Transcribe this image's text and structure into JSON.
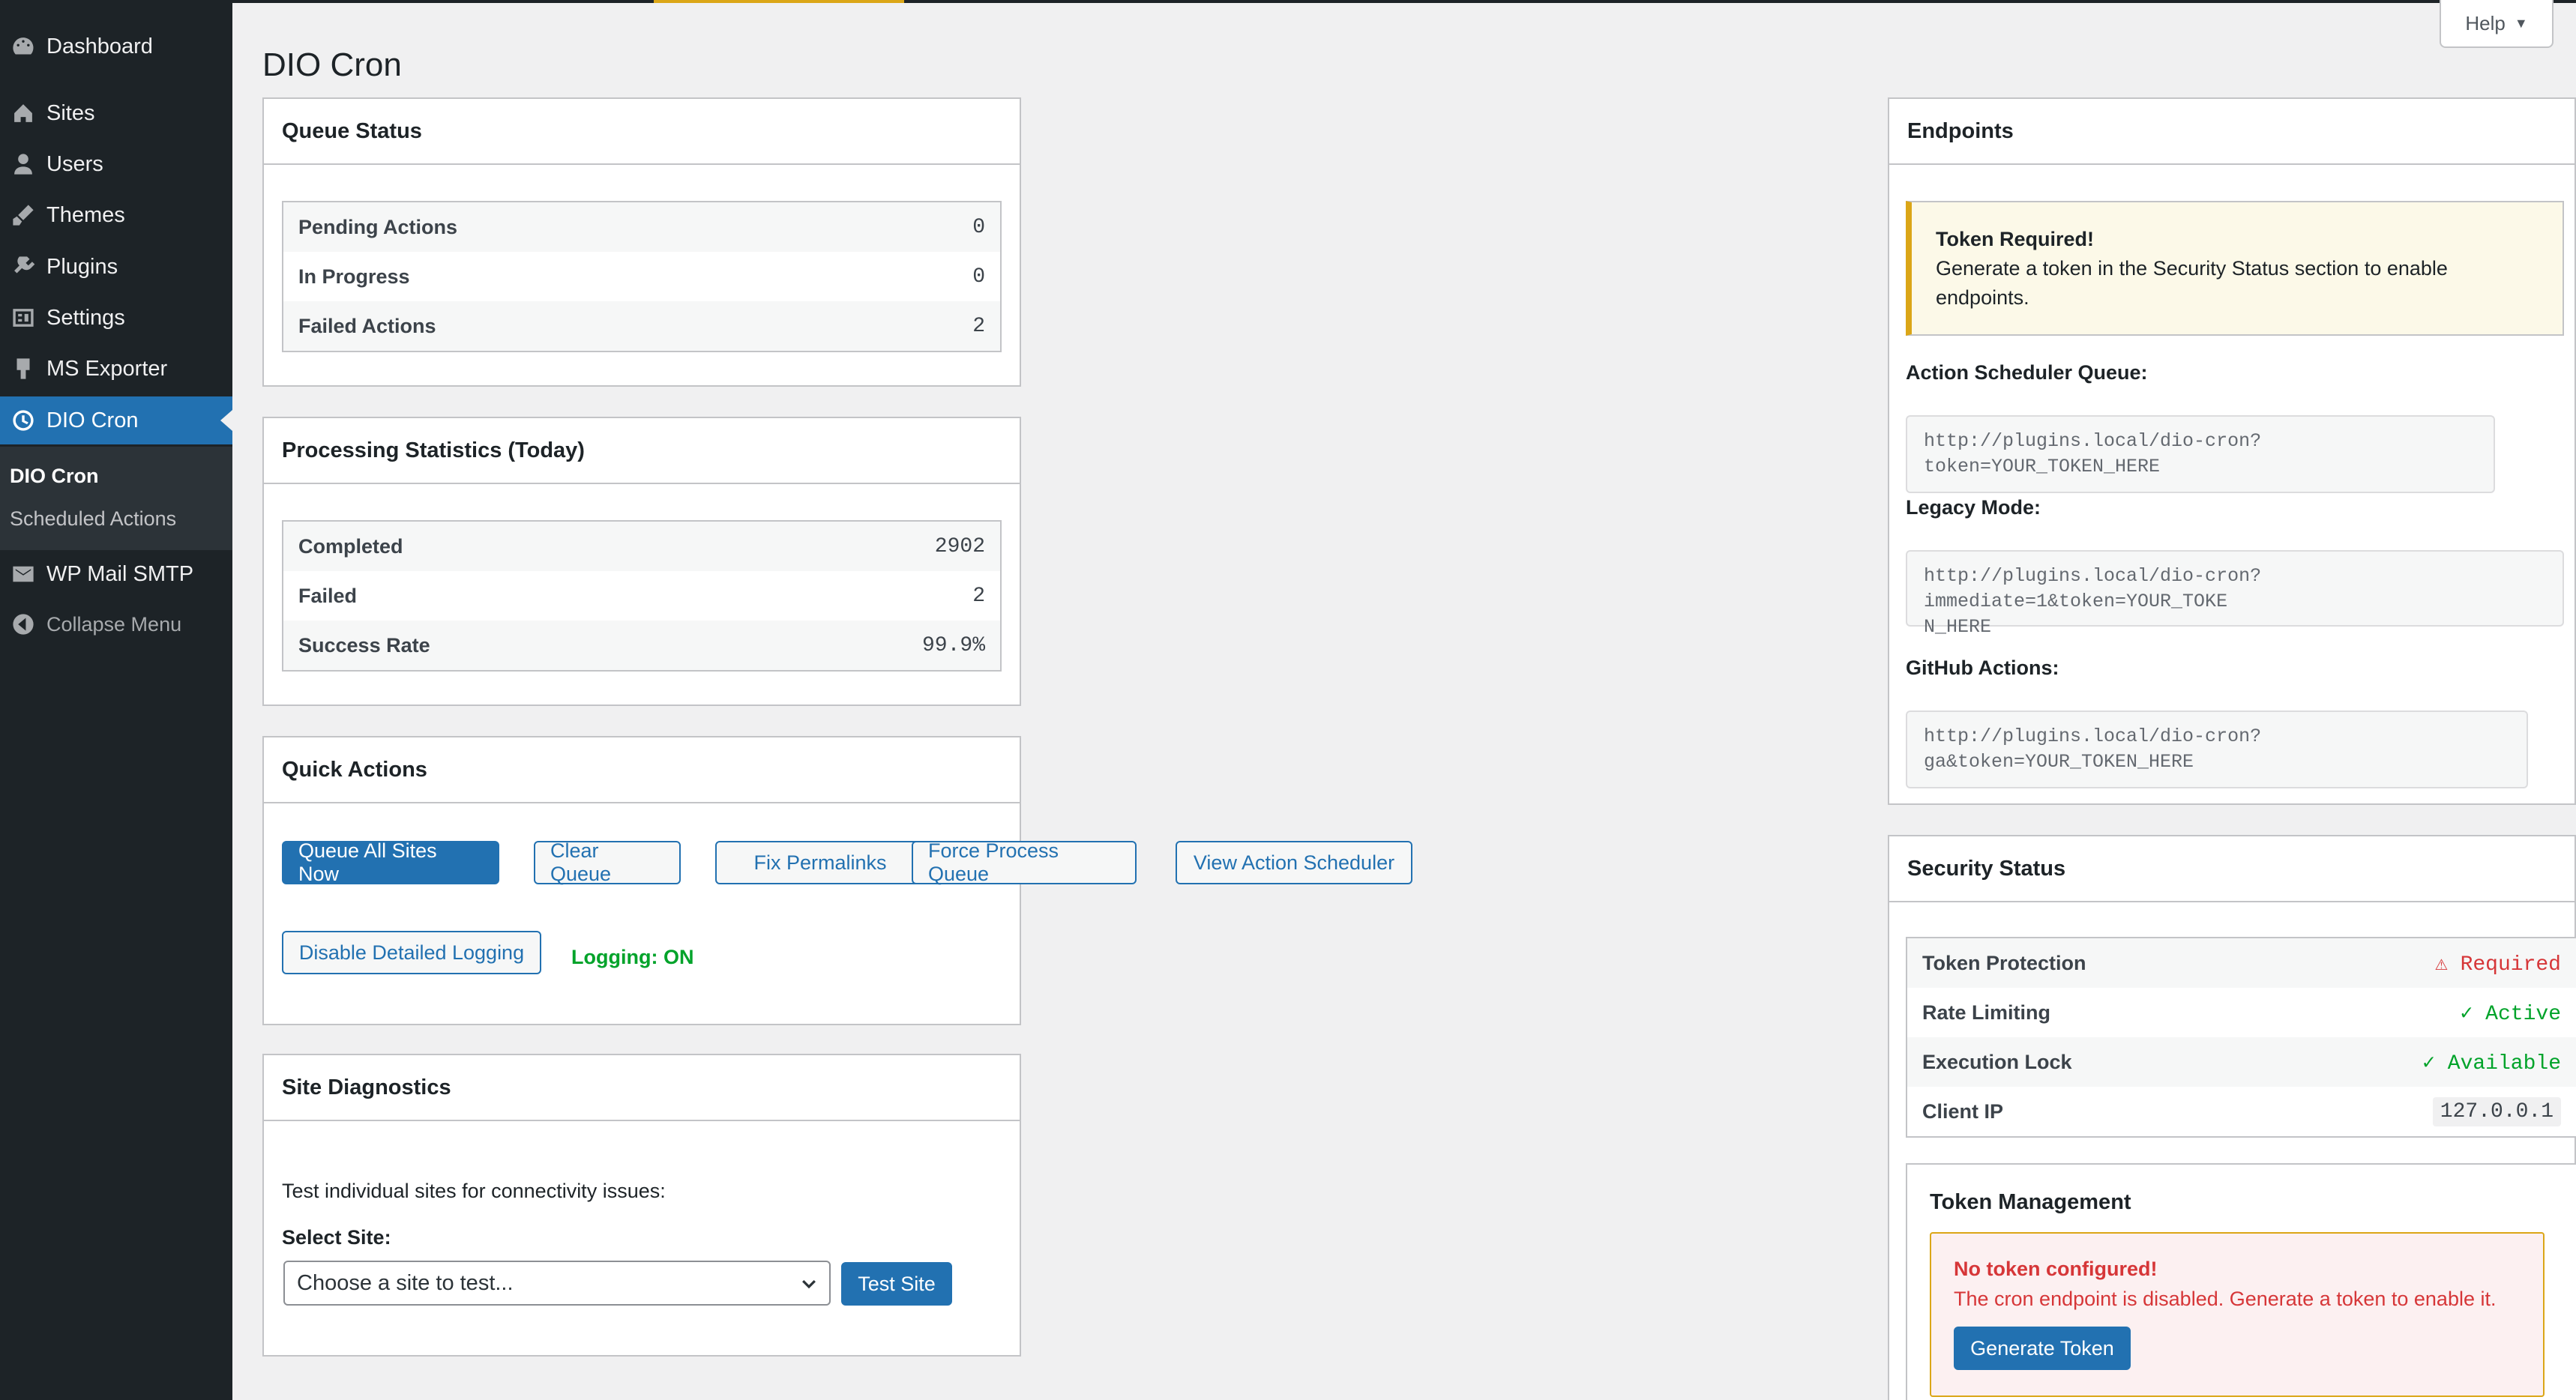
{
  "sidebar": {
    "items": [
      {
        "label": "Dashboard",
        "icon": "dashboard-icon"
      },
      {
        "label": "Sites",
        "icon": "sites-icon"
      },
      {
        "label": "Users",
        "icon": "users-icon"
      },
      {
        "label": "Themes",
        "icon": "themes-icon"
      },
      {
        "label": "Plugins",
        "icon": "plugins-icon"
      },
      {
        "label": "Settings",
        "icon": "settings-icon"
      },
      {
        "label": "MS Exporter",
        "icon": "exporter-icon"
      },
      {
        "label": "DIO Cron",
        "icon": "clock-icon"
      }
    ],
    "submenu": [
      "DIO Cron",
      "Scheduled Actions"
    ],
    "after": {
      "label": "WP Mail SMTP"
    },
    "collapse": "Collapse Menu"
  },
  "help": {
    "label": "Help"
  },
  "page": {
    "title": "DIO Cron"
  },
  "queue_status": {
    "title": "Queue Status",
    "rows": [
      {
        "label": "Pending Actions",
        "value": "0"
      },
      {
        "label": "In Progress",
        "value": "0"
      },
      {
        "label": "Failed Actions",
        "value": "2"
      }
    ]
  },
  "processing": {
    "title": "Processing Statistics (Today)",
    "rows": [
      {
        "label": "Completed",
        "value": "2902"
      },
      {
        "label": "Failed",
        "value": "2"
      },
      {
        "label": "Success Rate",
        "value": "99.9%"
      }
    ]
  },
  "quick_actions": {
    "title": "Quick Actions",
    "buttons": [
      "Queue All Sites Now",
      "Clear Queue",
      "Fix Permalinks",
      "Force Process Queue",
      "View Action Scheduler"
    ],
    "logging_button": "Disable Detailed Logging",
    "logging_status": "Logging: ON"
  },
  "diagnostics": {
    "title": "Site Diagnostics",
    "description": "Test individual sites for connectivity issues:",
    "select_label": "Select Site:",
    "select_value": "Choose a site to test...",
    "test_button": "Test Site"
  },
  "endpoints": {
    "title": "Endpoints",
    "notice_title": "Token Required!",
    "notice_text": "Generate a token in the Security Status section to enable endpoints.",
    "action_label": "Action Scheduler Queue:",
    "action_url": "http://plugins.local/dio-cron?token=YOUR_TOKEN_HERE",
    "legacy_label": "Legacy Mode:",
    "legacy_url_1": "http://plugins.local/dio-cron?immediate=1&token=YOUR_TOKE",
    "legacy_url_2": "N_HERE",
    "github_label": "GitHub Actions:",
    "github_url": "http://plugins.local/dio-cron?ga&token=YOUR_TOKEN_HERE"
  },
  "security": {
    "title": "Security Status",
    "rows": [
      {
        "label": "Token Protection",
        "value": "⚠ Required"
      },
      {
        "label": "Rate Limiting",
        "value": "✓ Active"
      },
      {
        "label": "Execution Lock",
        "value": "✓ Available"
      },
      {
        "label": "Client IP",
        "value": "127.0.0.1"
      }
    ],
    "token_title": "Token Management",
    "err_title": "No token configured!",
    "err_text": "The cron endpoint is disabled. Generate a token to enable it.",
    "generate_button": "Generate Token"
  }
}
